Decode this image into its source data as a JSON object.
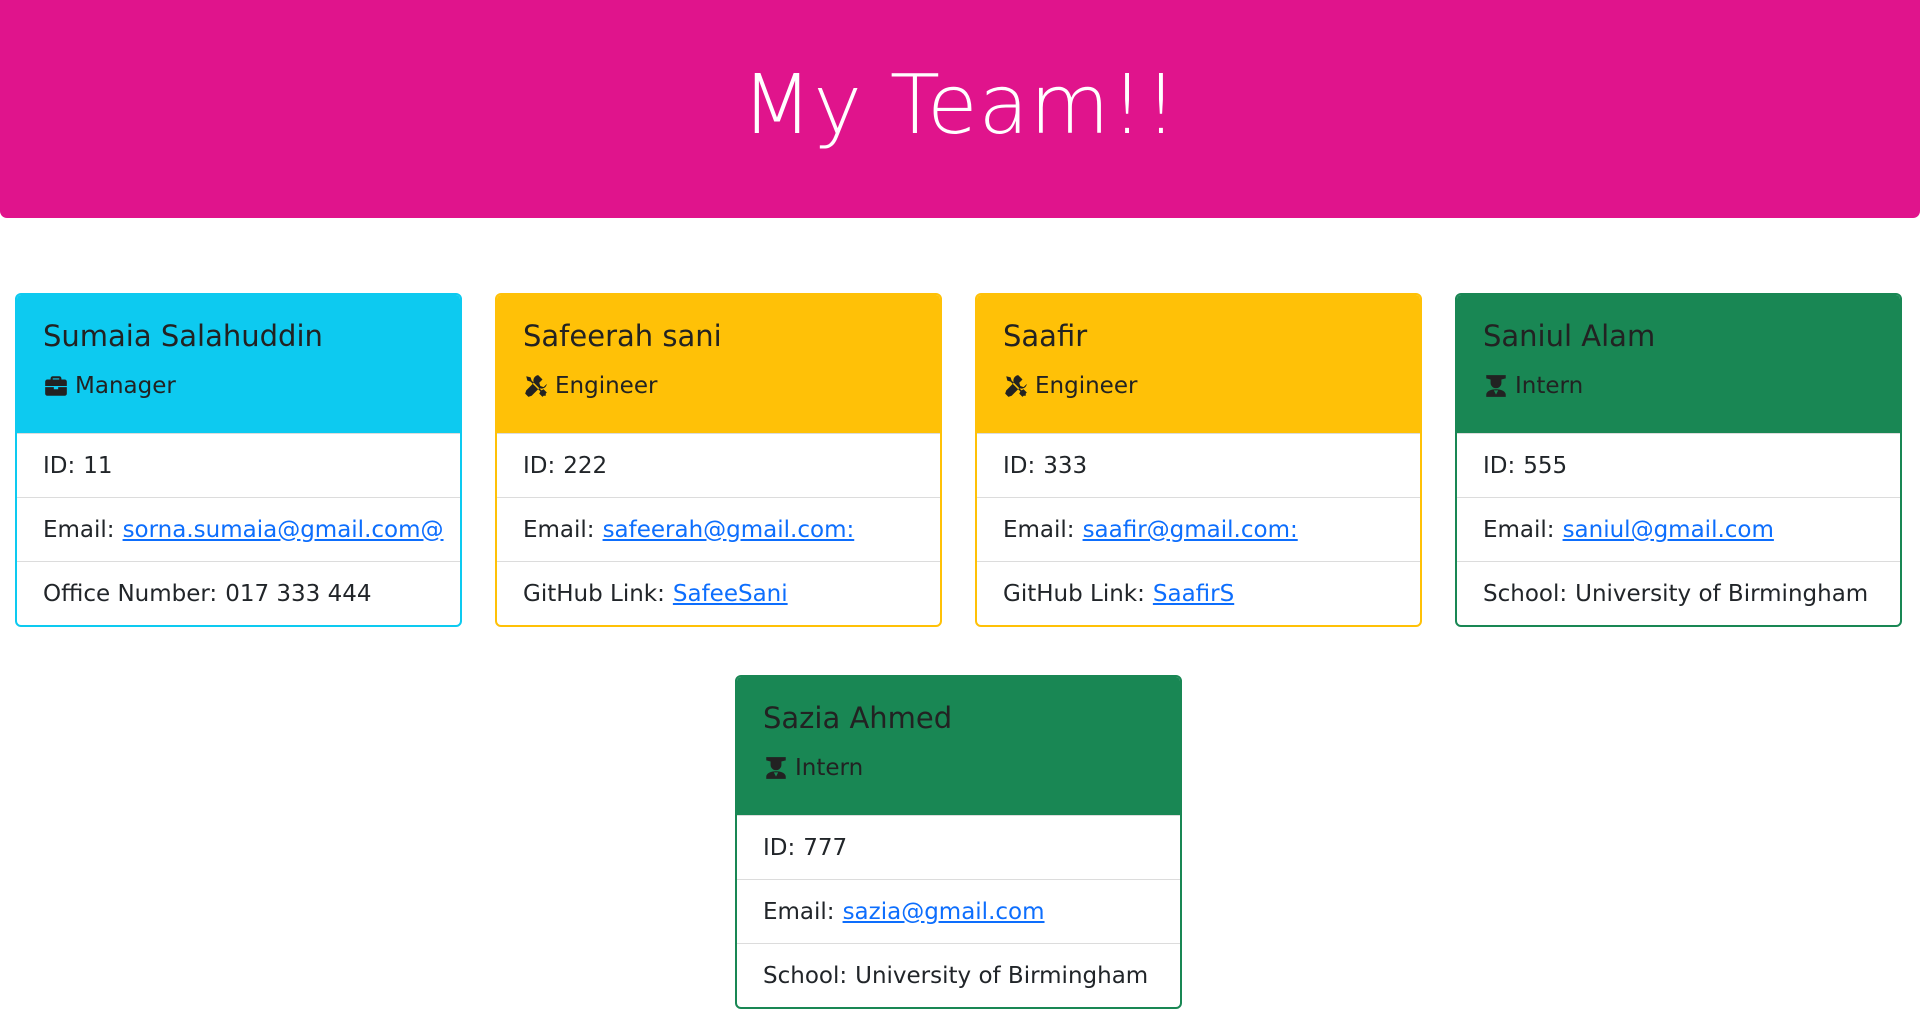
{
  "header": {
    "title": "My Team!!",
    "background": "#e0148c"
  },
  "colors": {
    "manager": "#0dcaf0",
    "engineer": "#ffc107",
    "intern": "#198754",
    "link": "#0d6efd"
  },
  "cards": [
    {
      "name": "Sumaia Salahuddin",
      "role": "Manager",
      "role_icon": "briefcase-icon",
      "id_label": "ID:",
      "id": "11",
      "email_label": "Email:",
      "email": "sorna.sumaia@gmail.com@",
      "extra_label": "Office Number:",
      "extra_value": "017 333 444"
    },
    {
      "name": "Safeerah sani",
      "role": "Engineer",
      "role_icon": "tools-icon",
      "id_label": "ID:",
      "id": "222",
      "email_label": "Email:",
      "email": "safeerah@gmail.com:",
      "extra_label": "GitHub Link:",
      "extra_value": "SafeeSani"
    },
    {
      "name": "Saafir",
      "role": "Engineer",
      "role_icon": "tools-icon",
      "id_label": "ID:",
      "id": "333",
      "email_label": "Email:",
      "email": "saafir@gmail.com:",
      "extra_label": "GitHub Link:",
      "extra_value": "SaafirS"
    },
    {
      "name": "Saniul Alam",
      "role": "Intern",
      "role_icon": "graduate-icon",
      "id_label": "ID:",
      "id": "555",
      "email_label": "Email:",
      "email": "saniul@gmail.com",
      "extra_label": "School:",
      "extra_value": "University of Birmingham"
    },
    {
      "name": "Sazia Ahmed",
      "role": "Intern",
      "role_icon": "graduate-icon",
      "id_label": "ID:",
      "id": "777",
      "email_label": "Email:",
      "email": "sazia@gmail.com",
      "extra_label": "School:",
      "extra_value": "University of Birmingham"
    }
  ]
}
